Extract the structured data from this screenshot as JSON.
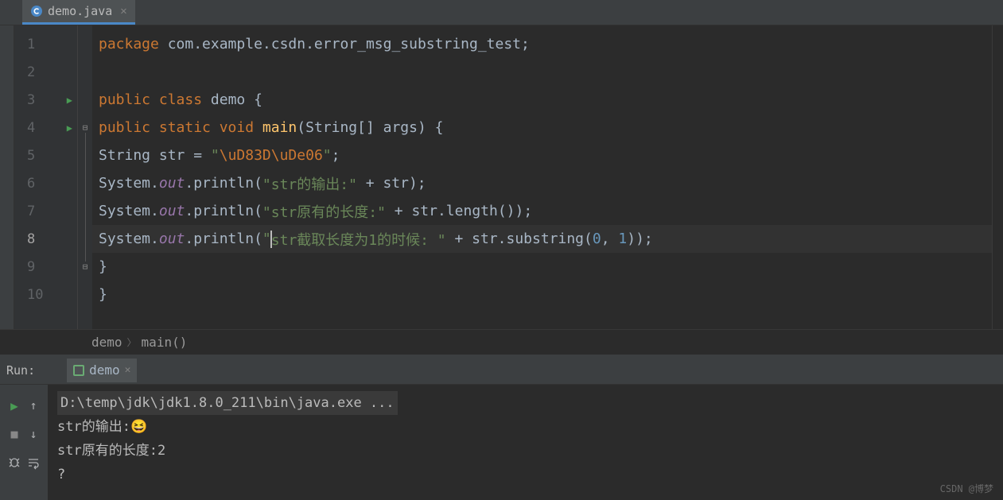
{
  "tab": {
    "filename": "demo.java",
    "icon": "class-icon"
  },
  "gutter": {
    "lines": [
      1,
      2,
      3,
      4,
      5,
      6,
      7,
      8,
      9,
      10
    ],
    "active_line": 8,
    "run_markers": [
      3,
      4
    ]
  },
  "code": {
    "package_kw": "package ",
    "package_name": "com.example.csdn.error_msg_substring_test",
    "semicolon": ";",
    "public_kw": "public ",
    "class_kw": "class ",
    "class_name": "demo ",
    "brace_open": "{",
    "brace_close": "}",
    "static_kw": "static ",
    "void_kw": "void ",
    "main_name": "main",
    "main_params": "(String[] args) ",
    "string_type": "String str = ",
    "string_literal_open": "\"",
    "escape1": "\\uD83D\\uDe06",
    "string_literal_close": "\"",
    "system": "System.",
    "out": "out",
    "println": ".println(",
    "str1": "\"str的输出:\"",
    "plus_str": " + str);",
    "str2": "\"str原有的长度:\"",
    "plus_len": " + str.length());",
    "str3a": "\"",
    "str3b": "str截取长度为1的时候: \"",
    "plus_sub": " + str.substring(",
    "zero": "0",
    "comma": ", ",
    "one": "1",
    "close_call": "));"
  },
  "breadcrumb": {
    "item1": "demo",
    "item2": "main()"
  },
  "run": {
    "label": "Run:",
    "tab_name": "demo",
    "output": [
      "D:\\temp\\jdk\\jdk1.8.0_211\\bin\\java.exe ...",
      "str的输出:😆",
      "str原有的长度:2",
      "?"
    ]
  },
  "watermark": "CSDN @博梦"
}
